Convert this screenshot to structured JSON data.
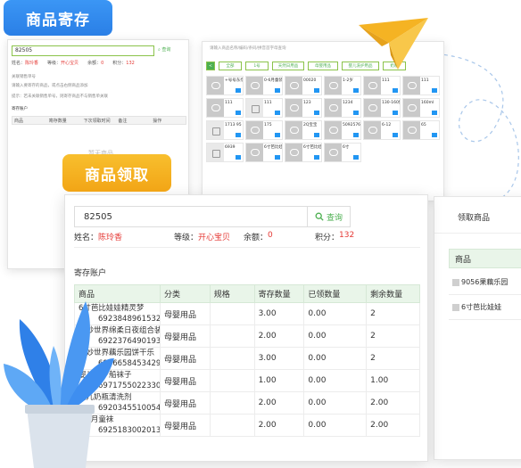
{
  "badges": {
    "store": "商品寄存",
    "claim": "商品领取"
  },
  "back_left": {
    "search_value": "82505",
    "query_label": "查询",
    "info": {
      "name_label": "姓名：",
      "name_value": "陈玲香",
      "level_label": "等级：",
      "level_value": "开心宝贝",
      "balance_label": "余额：",
      "balance_value": "0",
      "points_label": "积分：",
      "points_value": "132"
    },
    "hint_title": "关联销售单号",
    "hint_line": "请输入要寄存的商品，或点击右侧商品添加",
    "note_line": "提示：若未关联销售单号，则寄存商品不与销售单关联",
    "section_label": "寄存账户",
    "columns": [
      "商品",
      "寄存数量",
      "下次领取时间",
      "备注",
      "操作"
    ],
    "empty_text": "暂无商品"
  },
  "back_right": {
    "search_placeholder": "请输入商品名称/编码/条码/拼音首字母查询",
    "categories": [
      "<",
      "全部",
      "1号",
      "天然日用品",
      "母婴用品",
      "婴儿洗护用品",
      "奶粉"
    ],
    "products": [
      {
        "name": "+号号东奈奶粉"
      },
      {
        "name": "0-6月童装"
      },
      {
        "name": "00020"
      },
      {
        "name": "1-2岁"
      },
      {
        "name": "111",
        "bag": false
      },
      {
        "name": "111"
      },
      {
        "name": "111"
      },
      {
        "name": "111"
      },
      {
        "name": "123"
      },
      {
        "name": "1234"
      },
      {
        "name": "130-160加长"
      },
      {
        "name": "160ml"
      },
      {
        "name": "1713 95"
      },
      {
        "name": "175"
      },
      {
        "name": "2Q宝宝"
      },
      {
        "name": "5092576"
      },
      {
        "name": "6-12"
      },
      {
        "name": "65"
      },
      {
        "name": "6939"
      },
      {
        "name": "6寸芭比娃娃"
      },
      {
        "name": "6寸芭比娃娃"
      },
      {
        "name": "6寸"
      }
    ]
  },
  "front": {
    "search_value": "82505",
    "query_label": "查询",
    "info": {
      "name_label": "姓名：",
      "name_value": "陈玲香",
      "level_label": "等级：",
      "level_value": "开心宝贝",
      "balance_label": "余额：",
      "balance_value": "0",
      "points_label": "积分：",
      "points_value": "132"
    },
    "section_label": "寄存账户",
    "columns": [
      "商品",
      "分类",
      "规格",
      "寄存数量",
      "已领数量",
      "剩余数量"
    ],
    "rows": [
      {
        "name1": "6寸芭比娃娃精灵梦",
        "name2": "6923848961532",
        "category": "母婴用品",
        "spec": "",
        "stored": "3.00",
        "claimed": "0.00",
        "remaining": "2"
      },
      {
        "name1": "奇妙世界绵柔日夜组合装",
        "name2": "6922376490193",
        "category": "母婴用品",
        "spec": "",
        "stored": "2.00",
        "claimed": "0.00",
        "remaining": "2"
      },
      {
        "name1": "奇妙世界藕乐园饼干乐",
        "name2": "6956658453429",
        "category": "母婴用品",
        "spec": "",
        "stored": "3.00",
        "claimed": "0.00",
        "remaining": "2"
      },
      {
        "name1": "婴儿学步船袜子",
        "name2": "6971755022330",
        "category": "母婴用品",
        "spec": "",
        "stored": "1.00",
        "claimed": "0.00",
        "remaining": "1.00"
      },
      {
        "name1": "婴儿奶瓶清洗剂",
        "name2": "6920345510054",
        "category": "母婴用品",
        "spec": "",
        "stored": "2.00",
        "claimed": "0.00",
        "remaining": "2.00"
      },
      {
        "name1": "0-6月童袜",
        "name2": "6925183002013",
        "category": "母婴用品",
        "spec": "",
        "stored": "2.00",
        "claimed": "0.00",
        "remaining": "2.00"
      }
    ]
  },
  "right_panel": {
    "title": "领取商品",
    "column": "商品",
    "rows": [
      "9056果藕乐园",
      "6寸芭比娃娃"
    ]
  },
  "colors": {
    "blue_badge": "#2a7fe6",
    "yellow_badge": "#f2a516",
    "green_accent": "#4caf50",
    "red_text": "#e53935",
    "plane": "#f5b323",
    "plant": "#3c8df0"
  }
}
